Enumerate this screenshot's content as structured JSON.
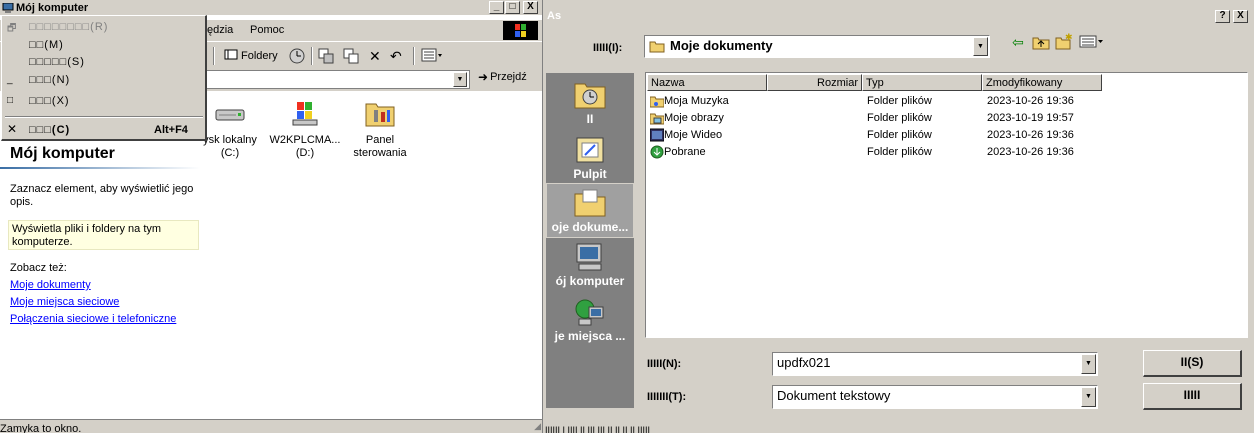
{
  "explorer": {
    "title": "Mój komputer",
    "title_buttons": [
      "_",
      "□",
      "X"
    ],
    "menu": {
      "tools": "ędzia",
      "help": "Pomoc"
    },
    "toolbar": {
      "folders": "Foldery"
    },
    "address": {
      "go": "Przejdź"
    },
    "icons": [
      {
        "label": "ysk lokalny\n(C:)",
        "icon": "drive-icon"
      },
      {
        "label": "W2KPLCMA...\n(D:)",
        "icon": "windows-cd-icon"
      },
      {
        "label": "Panel\nsterowania",
        "icon": "control-panel-icon"
      }
    ],
    "panel": {
      "title": "Mój komputer",
      "hint": "Zaznacz element, aby wyświetlić jego opis.",
      "info": "Wyświetla pliki i foldery na tym komputerze.",
      "see_also": "Zobacz też:",
      "links": [
        "Moje dokumenty",
        "Moje miejsca sieciowe",
        "Połączenia sieciowe i telefoniczne"
      ]
    },
    "status": "Zamyka to okno."
  },
  "system_menu": {
    "items": [
      {
        "icon": "🗗",
        "label": "□□□□□□□□(R)",
        "accel": "",
        "disabled": true
      },
      {
        "icon": "",
        "label": "□□(M)",
        "accel": "",
        "disabled": false
      },
      {
        "icon": "",
        "label": "□□□□□(S)",
        "accel": "",
        "disabled": false
      },
      {
        "icon": "_",
        "label": "□□□(N)",
        "accel": "",
        "disabled": false
      },
      {
        "icon": "□",
        "label": "□□□(X)",
        "accel": "",
        "disabled": false
      },
      {
        "icon": "✕",
        "label": "□□□(C)",
        "accel": "Alt+F4",
        "disabled": false
      }
    ]
  },
  "dialog": {
    "title": "As",
    "help_btn": "?",
    "close_btn": "X",
    "lookin_label": "IIIII(I):",
    "lookin_value": "Moje dokumenty",
    "places": [
      "II",
      "Pulpit",
      "oje dokume...",
      "ój komputer",
      "je miejsca ..."
    ],
    "columns": [
      "Nazwa",
      "Rozmiar",
      "Typ",
      "Zmodyfikowany"
    ],
    "files": [
      {
        "name": "Moja Muzyka",
        "size": "",
        "type": "Folder plików",
        "modified": "2023-10-26 19:36",
        "icon": "music-folder-icon"
      },
      {
        "name": "Moje obrazy",
        "size": "",
        "type": "Folder plików",
        "modified": "2023-10-19 19:57",
        "icon": "pictures-folder-icon"
      },
      {
        "name": "Moje Wideo",
        "size": "",
        "type": "Folder plików",
        "modified": "2023-10-26 19:36",
        "icon": "video-folder-icon"
      },
      {
        "name": "Pobrane",
        "size": "",
        "type": "Folder plików",
        "modified": "2023-10-26 19:36",
        "icon": "downloads-folder-icon"
      }
    ],
    "filename_label": "IIIII(N):",
    "filename_value": "updfx021",
    "filetype_label": "IIIIIII(T):",
    "filetype_value": "Dokument tekstowy",
    "save_btn": "II(S)",
    "cancel_btn": "IIIII"
  },
  "taskbar_text": "IIIIII I  IIII II III III II  II II II IIIII"
}
